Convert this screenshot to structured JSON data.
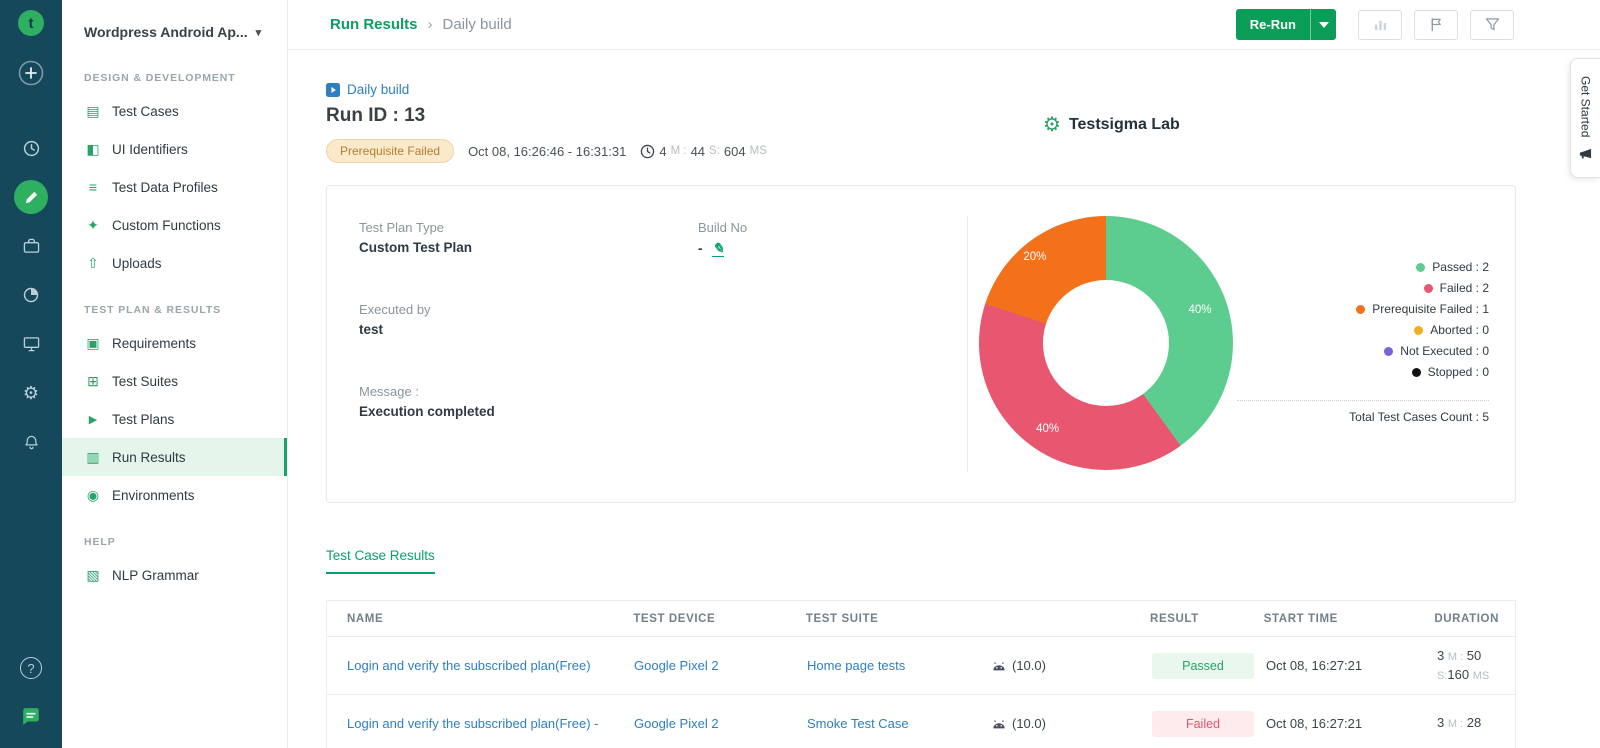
{
  "icons": {
    "logo_text": "t",
    "chevron_down": "▾",
    "breadcrumb_sep": "›",
    "gear_glyph": "⚙",
    "help_glyph": "?",
    "lab_gear": "⚙",
    "edit_pencil": "✎",
    "test_cases": "▤",
    "ui_identifiers": "◧",
    "test_data_profiles": "≡",
    "custom_functions": "✦",
    "uploads": "⇧",
    "requirements": "▣",
    "test_suites": "⊞",
    "test_plans": "▶",
    "run_results": "▥",
    "environments": "◉",
    "nlp_grammar": "▧"
  },
  "project": {
    "name": "Wordpress Android Ap..."
  },
  "sidebar": {
    "sections": [
      {
        "label": "DESIGN & DEVELOPMENT",
        "items": [
          {
            "label": "Test Cases"
          },
          {
            "label": "UI Identifiers"
          },
          {
            "label": "Test Data Profiles"
          },
          {
            "label": "Custom Functions"
          },
          {
            "label": "Uploads"
          }
        ]
      },
      {
        "label": "TEST PLAN & RESULTS",
        "items": [
          {
            "label": "Requirements"
          },
          {
            "label": "Test Suites"
          },
          {
            "label": "Test Plans"
          },
          {
            "label": "Run Results"
          },
          {
            "label": "Environments"
          }
        ]
      },
      {
        "label": "HELP",
        "items": [
          {
            "label": "NLP Grammar"
          }
        ]
      }
    ]
  },
  "topbar": {
    "breadcrumb_current": "Run Results",
    "breadcrumb_page": "Daily build",
    "rerun": "Re-Run"
  },
  "get_started": "Get Started",
  "run": {
    "build_name": "Daily build",
    "run_id": "Run ID : 13",
    "status": "Prerequisite Failed",
    "time_range": "Oct 08, 16:26:46 - 16:31:31",
    "duration": {
      "m": "4",
      "mu": "M :",
      "s": "44",
      "su": "S:",
      "ms": "604",
      "msu": "MS"
    },
    "lab": "Testsigma Lab",
    "plan_type_label": "Test Plan Type",
    "plan_type": "Custom Test Plan",
    "build_no_label": "Build No",
    "build_no": "-",
    "executed_by_label": "Executed by",
    "executed_by": "test",
    "message_label": "Message :",
    "message": "Execution completed"
  },
  "chart_data": {
    "type": "pie",
    "donut": true,
    "legend_position": "right",
    "slices": [
      {
        "label": "Passed",
        "count": 2,
        "pct": 40,
        "color": "#5dcd8f",
        "text": "Passed : 2",
        "pct_label": "40%"
      },
      {
        "label": "Failed",
        "count": 2,
        "pct": 40,
        "color": "#e8566f",
        "text": "Failed : 2",
        "pct_label": "40%"
      },
      {
        "label": "Prerequisite Failed",
        "count": 1,
        "pct": 20,
        "color": "#f4711c",
        "text": "Prerequisite Failed : 1",
        "pct_label": "20%"
      },
      {
        "label": "Aborted",
        "count": 0,
        "pct": 0,
        "color": "#efb021",
        "text": "Aborted : 0"
      },
      {
        "label": "Not Executed",
        "count": 0,
        "pct": 0,
        "color": "#7a62d8",
        "text": "Not Executed : 0"
      },
      {
        "label": "Stopped",
        "count": 0,
        "pct": 0,
        "color": "#111111",
        "text": "Stopped : 0"
      }
    ],
    "total_text": "Total Test Cases Count : 5"
  },
  "tabs": {
    "test_case_results": "Test Case Results"
  },
  "table": {
    "columns": [
      "NAME",
      "TEST DEVICE",
      "TEST SUITE",
      "RESULT",
      "START TIME",
      "DURATION"
    ],
    "rows": [
      {
        "name": "Login and verify the subscribed plan(Free)",
        "device": "Google Pixel 2",
        "suite": "Home page tests",
        "os": "(10.0)",
        "result": "Passed",
        "start": "Oct 08, 16:27:21",
        "dur": {
          "a": "3",
          "au": "M :",
          "b": "50",
          "cu": "S:",
          "c": "160",
          "du": "MS"
        }
      },
      {
        "name": "Login and verify the subscribed plan(Free) -",
        "device": "Google Pixel 2",
        "suite": "Smoke Test Case",
        "os": "(10.0)",
        "result": "Failed",
        "start": "Oct 08, 16:27:21",
        "dur": {
          "a": "3",
          "au": "M :",
          "b": "28",
          "cu": "",
          "c": "",
          "du": ""
        }
      }
    ]
  }
}
